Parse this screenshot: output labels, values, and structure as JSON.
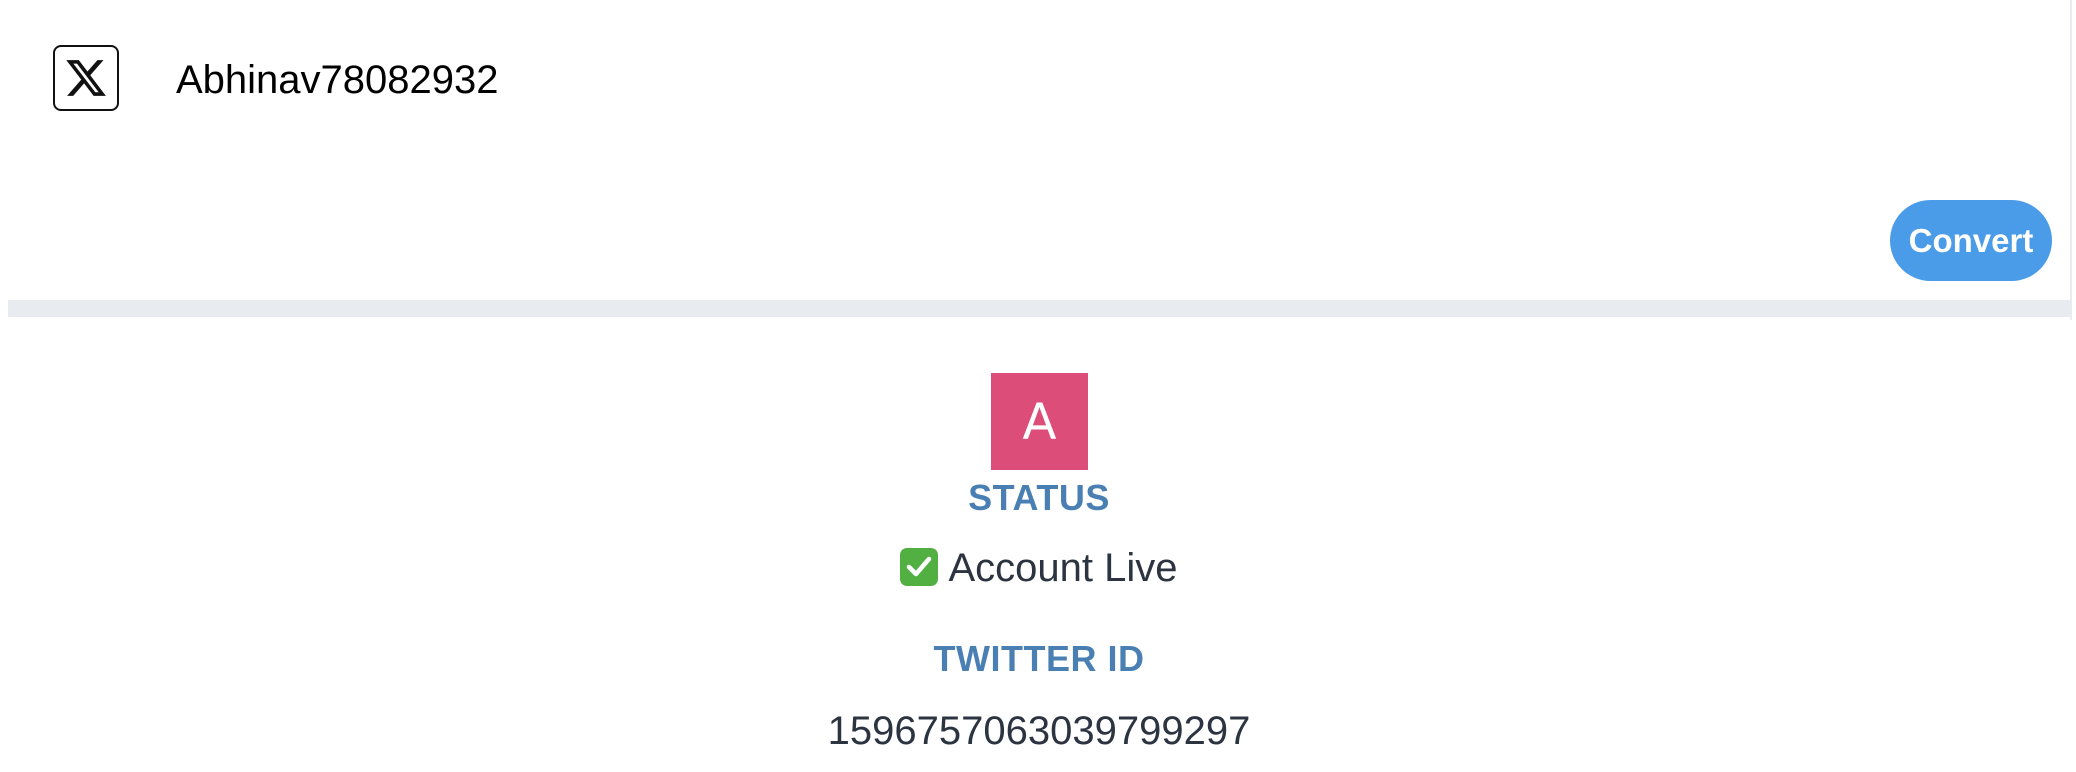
{
  "input": {
    "logo_icon": "x-logo-icon",
    "username_value": "Abhinav78082932",
    "convert_label": "Convert"
  },
  "result": {
    "avatar_letter": "A",
    "avatar_color": "#dc4d7a",
    "status_label": "STATUS",
    "status_icon": "check-mark-icon",
    "status_value": "Account Live",
    "twitter_id_label": "TWITTER ID",
    "twitter_id_value": "1596757063039799297"
  },
  "colors": {
    "accent": "#4a9be8",
    "label": "#4a7fb3",
    "separator": "#e8ebef",
    "success": "#52b043"
  }
}
